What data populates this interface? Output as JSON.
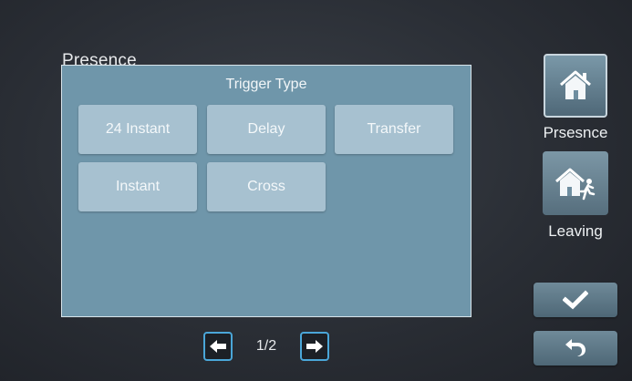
{
  "page": {
    "title": "Presence"
  },
  "dialog": {
    "title": "Trigger Type",
    "options": [
      "24 Instant",
      "Delay",
      "Transfer",
      "Instant",
      "Cross"
    ]
  },
  "pager": {
    "indicator": "1/2",
    "prev_icon": "arrow-left-icon",
    "next_icon": "arrow-right-icon"
  },
  "sidebar": {
    "presence": {
      "label": "Prsesnce",
      "icon": "home-icon",
      "active": true
    },
    "leaving": {
      "label": "Leaving",
      "icon": "home-leaving-icon",
      "active": false
    }
  },
  "actions": {
    "confirm_icon": "checkmark-icon",
    "back_icon": "return-icon"
  },
  "colors": {
    "dialog_bg": "#6f96aa",
    "option_bg": "#a7c1d0",
    "accent": "#4aa6d8"
  }
}
